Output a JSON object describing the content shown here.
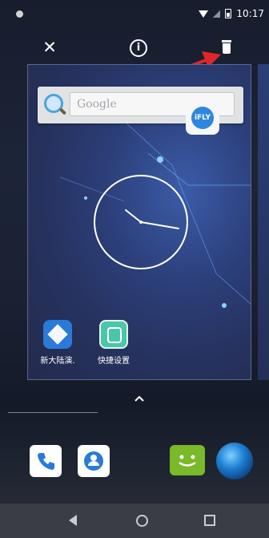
{
  "status_bar": {
    "time": "10:17",
    "icons": [
      "dot-icon",
      "wifi-icon",
      "signal-icon",
      "battery-icon"
    ]
  },
  "recents_actions": {
    "close_icon": "close-icon",
    "info_label": "i",
    "trash_icon": "trash-icon"
  },
  "recent_card": {
    "search_widget": {
      "placeholder": "Google",
      "icon": "search-icon"
    },
    "floating_app": {
      "label": "iFLY"
    },
    "apps": [
      {
        "label": "新大陆演.",
        "icon": "app-diamond-icon"
      },
      {
        "label": "快捷设置",
        "icon": "quick-settings-icon"
      }
    ]
  },
  "dock": {
    "icons": [
      "phone-icon",
      "contacts-icon",
      "messaging-icon",
      "browser-globe-icon"
    ]
  },
  "nav_bar": {
    "icons": [
      "back-icon",
      "home-icon",
      "recents-icon"
    ]
  },
  "colors": {
    "arrow": "#e1262b",
    "accent": "#2a7ad8"
  }
}
